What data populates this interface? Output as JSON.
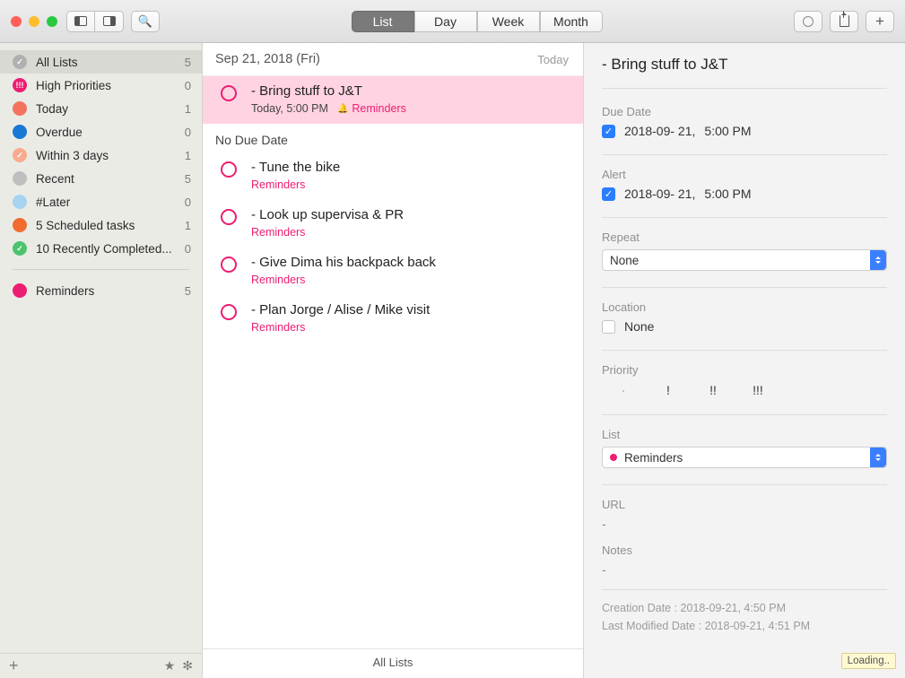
{
  "toolbar": {
    "views": [
      "List",
      "Day",
      "Week",
      "Month"
    ],
    "active_view": 0
  },
  "sidebar": {
    "items": [
      {
        "label": "All Lists",
        "count": "5",
        "color": "#b0b0b0",
        "glyph": "✓",
        "sel": true
      },
      {
        "label": "High Priorities",
        "count": "0",
        "color": "#ec1e73",
        "glyph": "!!!"
      },
      {
        "label": "Today",
        "count": "1",
        "color": "#f3735f",
        "glyph": ""
      },
      {
        "label": "Overdue",
        "count": "0",
        "color": "#1878d4",
        "glyph": ""
      },
      {
        "label": "Within 3 days",
        "count": "1",
        "color": "#f9aa8f",
        "glyph": "✓"
      },
      {
        "label": "Recent",
        "count": "5",
        "color": "#bfbfbf",
        "glyph": ""
      },
      {
        "label": "#Later",
        "count": "0",
        "color": "#a7d3ef",
        "glyph": ""
      },
      {
        "label": "5 Scheduled tasks",
        "count": "1",
        "color": "#f26c2f",
        "glyph": ""
      },
      {
        "label": "10 Recently Completed...",
        "count": "0",
        "color": "#4cc46e",
        "glyph": "✓"
      }
    ],
    "lists": [
      {
        "label": "Reminders",
        "count": "5",
        "color": "#ec1e73",
        "glyph": ""
      }
    ]
  },
  "tasks": {
    "date_header": "Sep 21, 2018 (Fri)",
    "today_label": "Today",
    "section_no_due": "No Due Date",
    "footer": "All Lists",
    "scheduled": [
      {
        "title": "- Bring stuff to J&T",
        "time": "Today, 5:00 PM",
        "list": "Reminders",
        "has_alert": true,
        "sel": true
      }
    ],
    "no_due": [
      {
        "title": "- Tune the bike",
        "list": "Reminders"
      },
      {
        "title": "- Look up supervisa & PR",
        "list": "Reminders"
      },
      {
        "title": "- Give Dima his backpack back",
        "list": "Reminders"
      },
      {
        "title": "- Plan Jorge / Alise / Mike visit",
        "list": "Reminders"
      }
    ]
  },
  "detail": {
    "title": "- Bring stuff to J&T",
    "due_label": "Due Date",
    "due_checked": true,
    "due_date": "2018-09- 21,",
    "due_time": "5:00 PM",
    "alert_label": "Alert",
    "alert_checked": true,
    "alert_date": "2018-09- 21,",
    "alert_time": "5:00 PM",
    "repeat_label": "Repeat",
    "repeat_value": "None",
    "location_label": "Location",
    "location_value": "None",
    "priority_label": "Priority",
    "priority_opts": [
      "·",
      "!",
      "!!",
      "!!!"
    ],
    "list_label": "List",
    "list_value": "Reminders",
    "url_label": "URL",
    "url_value": "-",
    "notes_label": "Notes",
    "notes_value": "-",
    "created": "Creation Date : 2018-09-21, 4:50 PM",
    "modified": "Last Modified Date : 2018-09-21, 4:51 PM"
  },
  "loading": "Loading.."
}
